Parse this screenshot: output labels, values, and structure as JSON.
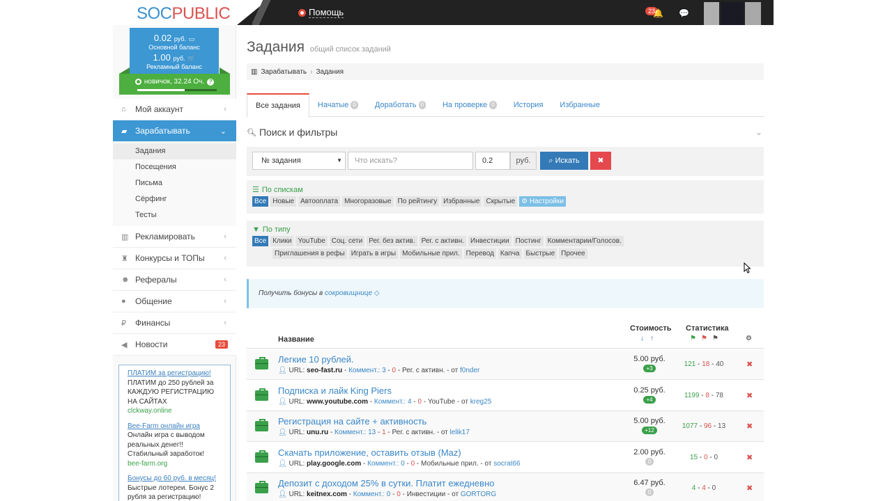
{
  "header": {
    "logo_part1": "SOC",
    "logo_part2": "PUBLIC",
    "help": "Помощь",
    "notifications": "23"
  },
  "sidebar": {
    "balance_main": "0.02",
    "balance_main_unit": "руб.",
    "balance_main_label": "Основной баланс",
    "balance_ad": "1.00",
    "balance_ad_unit": "руб.",
    "balance_ad_label": "Рекламный баланс",
    "level": "новичок, 32.24 Оч.",
    "level_progress": 0.6,
    "nav": [
      {
        "label": "Мой аккаунт",
        "icon": "home-icon"
      },
      {
        "label": "Зарабатывать",
        "icon": "briefcase-icon"
      },
      {
        "label": "Рекламировать",
        "icon": "chart-icon"
      },
      {
        "label": "Конкурсы и ТОПы",
        "icon": "trophy-icon"
      },
      {
        "label": "Рефералы",
        "icon": "users-icon"
      },
      {
        "label": "Общение",
        "icon": "comments-icon"
      },
      {
        "label": "Финансы",
        "icon": "ruble-icon"
      },
      {
        "label": "Новости",
        "icon": "bullhorn-icon",
        "badge": "23"
      }
    ],
    "sub": [
      "Задания",
      "Посещения",
      "Письма",
      "Сёрфинг",
      "Тесты"
    ],
    "ads": [
      {
        "title": "ПЛАТИМ за регистрацию!",
        "text": "ПЛАТИМ до 250 рублей за КАЖДУЮ РЕГИСТРАЦИЮ НА САЙТАХ",
        "domain": "clckway.online"
      },
      {
        "title": "Bee-Farm онлайн игра",
        "text": "Онлайн игра с выводом реальных денег!! Стабильный заработок!",
        "domain": "bee-farm.org"
      },
      {
        "title": "Бонусы до 60 руб. в месяц!",
        "text": "Быстрые лотереи. Бонус 2 рубля за регистрацию!",
        "domain": ""
      }
    ]
  },
  "main": {
    "title": "Задания",
    "subtitle": "общий список заданий",
    "breadcrumb": [
      "Зарабатывать",
      "Задания"
    ],
    "tabs": [
      {
        "label": "Все задания"
      },
      {
        "label": "Начатые",
        "count": "0"
      },
      {
        "label": "Доработать",
        "count": "0"
      },
      {
        "label": "На проверке",
        "count": "0"
      },
      {
        "label": "История"
      },
      {
        "label": "Избранные"
      }
    ],
    "filters_title": "Поиск и фильтры",
    "search": {
      "select": "№ задания",
      "query_placeholder": "Что искать?",
      "price": "0.2",
      "unit": "руб.",
      "button": "Искать"
    },
    "by_lists": {
      "label": "По спискам",
      "chips": [
        "Все",
        "Новые",
        "Автооплата",
        "Многоразовые",
        "По рейтингу",
        "Избранные",
        "Скрытые"
      ],
      "settings": "Настройки"
    },
    "by_type": {
      "label": "По типу",
      "chips": [
        "Все",
        "Клики",
        "YouTube",
        "Соц. сети",
        "Рег. без актив.",
        "Рег. с активн.",
        "Инвестиции",
        "Постинг",
        "Комментарии/Голосов."
      ],
      "chips2": [
        "Приглашения в рефы",
        "Играть в игры",
        "Мобильные прил.",
        "Перевод",
        "Капча",
        "Быстрые",
        "Прочее"
      ]
    },
    "bonus": {
      "text": "Получить бонусы в",
      "link": "сокровищнице"
    },
    "table": {
      "col_name": "Название",
      "col_cost": "Стоимость",
      "col_stats": "Статистика",
      "rows": [
        {
          "title": "Легкие 10 рублей.",
          "url": "seo-fast.ru",
          "comment_label": "Коммент.:",
          "c1": "3",
          "c2": "0",
          "type": "Рег. с активн.",
          "author": "f0nder",
          "price": "5.00 руб.",
          "badge": "+3",
          "s1": "121",
          "s2": "18",
          "s3": "40"
        },
        {
          "title": "Подписка и лайк King Piers",
          "url": "www.youtube.com",
          "comment_label": "Коммент.:",
          "c1": "4",
          "c2": "0",
          "type": "YouTube",
          "author": "kreg25",
          "price": "0.25 руб.",
          "badge": "+4",
          "s1": "1199",
          "s2": "8",
          "s3": "78"
        },
        {
          "title": "Регистрация на сайте + активность",
          "url": "unu.ru",
          "comment_label": "Коммент.:",
          "c1": "13",
          "c2": "1",
          "type": "Рег. с активн.",
          "author": "lelik17",
          "price": "5.00 руб.",
          "badge": "+12",
          "s1": "1077",
          "s2": "96",
          "s3": "13"
        },
        {
          "title": "Скачать приложение, оставить отзыв (Maz)",
          "url": "play.google.com",
          "comment_label": "Коммент.:",
          "c1": "0",
          "c2": "0",
          "type": "Мобильные прил.",
          "author": "socrat66",
          "price": "2.00 руб.",
          "badge": "0",
          "s1": "15",
          "s2": "0",
          "s3": "0"
        },
        {
          "title": "Депозит с доходом 25% в сутки. Платит ежедневно",
          "url": "keitnex.com",
          "comment_label": "Коммент.:",
          "c1": "0",
          "c2": "0",
          "type": "Инвестиции",
          "author": "GORTORG",
          "price": "6.47 руб.",
          "badge": "0",
          "s1": "4",
          "s2": "4",
          "s3": "0"
        }
      ]
    }
  },
  "colors": {
    "accent": "#3c97d3",
    "success": "#4caf3f",
    "danger": "#e74c3c"
  }
}
